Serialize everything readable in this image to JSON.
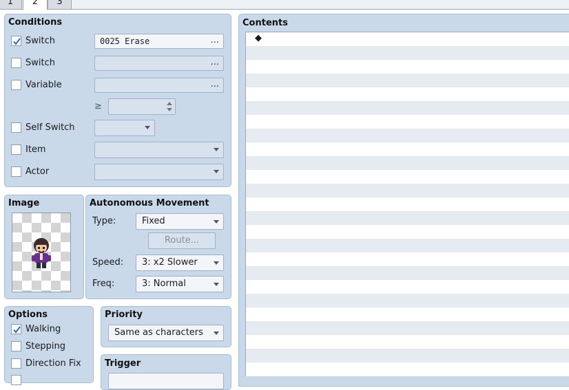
{
  "tabs": [
    "1",
    "2",
    "3"
  ],
  "conditions": {
    "title": "Conditions",
    "switch1": {
      "label": "Switch",
      "checked": true,
      "value": "0025 Erase",
      "button": "..."
    },
    "switch2": {
      "label": "Switch",
      "checked": false,
      "value": "",
      "button": "..."
    },
    "variable": {
      "label": "Variable",
      "checked": false,
      "value": "",
      "button": "...",
      "operator": "≥",
      "number": ""
    },
    "self_switch": {
      "label": "Self Switch",
      "checked": false,
      "value": ""
    },
    "item": {
      "label": "Item",
      "checked": false,
      "value": ""
    },
    "actor": {
      "label": "Actor",
      "checked": false,
      "value": ""
    }
  },
  "image": {
    "title": "Image"
  },
  "autonomous_movement": {
    "title": "Autonomous Movement",
    "type_label": "Type:",
    "type_value": "Fixed",
    "route_button": "Route...",
    "speed_label": "Speed:",
    "speed_value": "3: x2 Slower",
    "freq_label": "Freq:",
    "freq_value": "3: Normal"
  },
  "options": {
    "title": "Options",
    "walking": {
      "label": "Walking",
      "checked": true
    },
    "stepping": {
      "label": "Stepping",
      "checked": false
    },
    "direction_fix": {
      "label": "Direction Fix",
      "checked": false
    }
  },
  "priority": {
    "title": "Priority",
    "value": "Same as characters"
  },
  "trigger": {
    "title": "Trigger"
  },
  "contents": {
    "title": "Contents",
    "first_item": "◆"
  },
  "colors": {
    "panel": "#c9d9ea",
    "alt_row": "#e6ebf1",
    "character_outfit": "#6a2e8c"
  }
}
